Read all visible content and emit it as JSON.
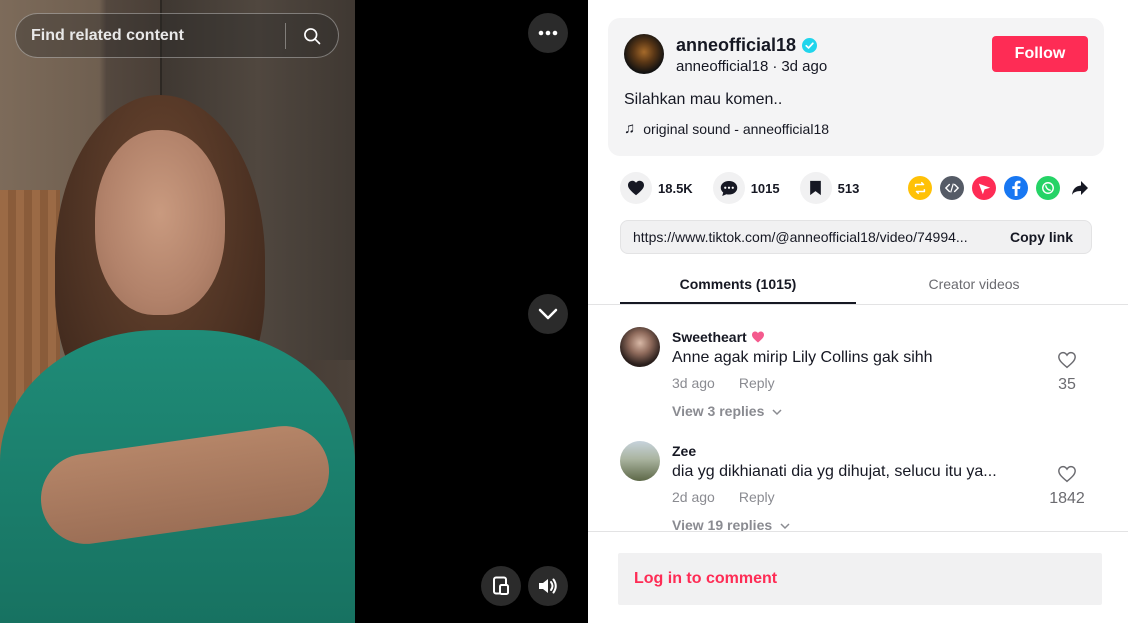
{
  "video": {
    "search_placeholder": "Find related content",
    "icons": {
      "search": "search-icon",
      "more": "more-dots-icon",
      "scroll_down": "chevron-down-icon",
      "floating_player": "floating-player-icon",
      "volume": "volume-icon"
    }
  },
  "author": {
    "username": "anneofficial18",
    "handle": "anneofficial18",
    "separator": "·",
    "posted": "3d ago",
    "follow_label": "Follow",
    "description": "Silahkan mau komen..",
    "sound_label": "original sound - anneofficial18"
  },
  "stats": {
    "likes": "18.5K",
    "comments": "1015",
    "saves": "513"
  },
  "share": {
    "icons": [
      "repost-icon",
      "embed-icon",
      "send-icon",
      "facebook-icon",
      "whatsapp-icon",
      "share-arrow-icon"
    ]
  },
  "link": {
    "url": "https://www.tiktok.com/@anneofficial18/video/74994...",
    "copy_label": "Copy link"
  },
  "tabs": [
    {
      "label": "Comments (1015)"
    },
    {
      "label": "Creator videos"
    }
  ],
  "comments": [
    {
      "name": "Sweetheart",
      "text": "Anne agak mirip Lily Collins gak sihh",
      "time": "3d ago",
      "reply_label": "Reply",
      "likes": "35",
      "replies": "View 3 replies"
    },
    {
      "name": "Zee",
      "text": "dia yg dikhianati dia yg dihujat, selucu itu ya...",
      "time": "2d ago",
      "reply_label": "Reply",
      "likes": "1842",
      "replies": "View 19 replies"
    }
  ],
  "login": {
    "label": "Log in to comment"
  },
  "colors": {
    "accent": "#fe2c55",
    "verified": "#20d5ec"
  }
}
